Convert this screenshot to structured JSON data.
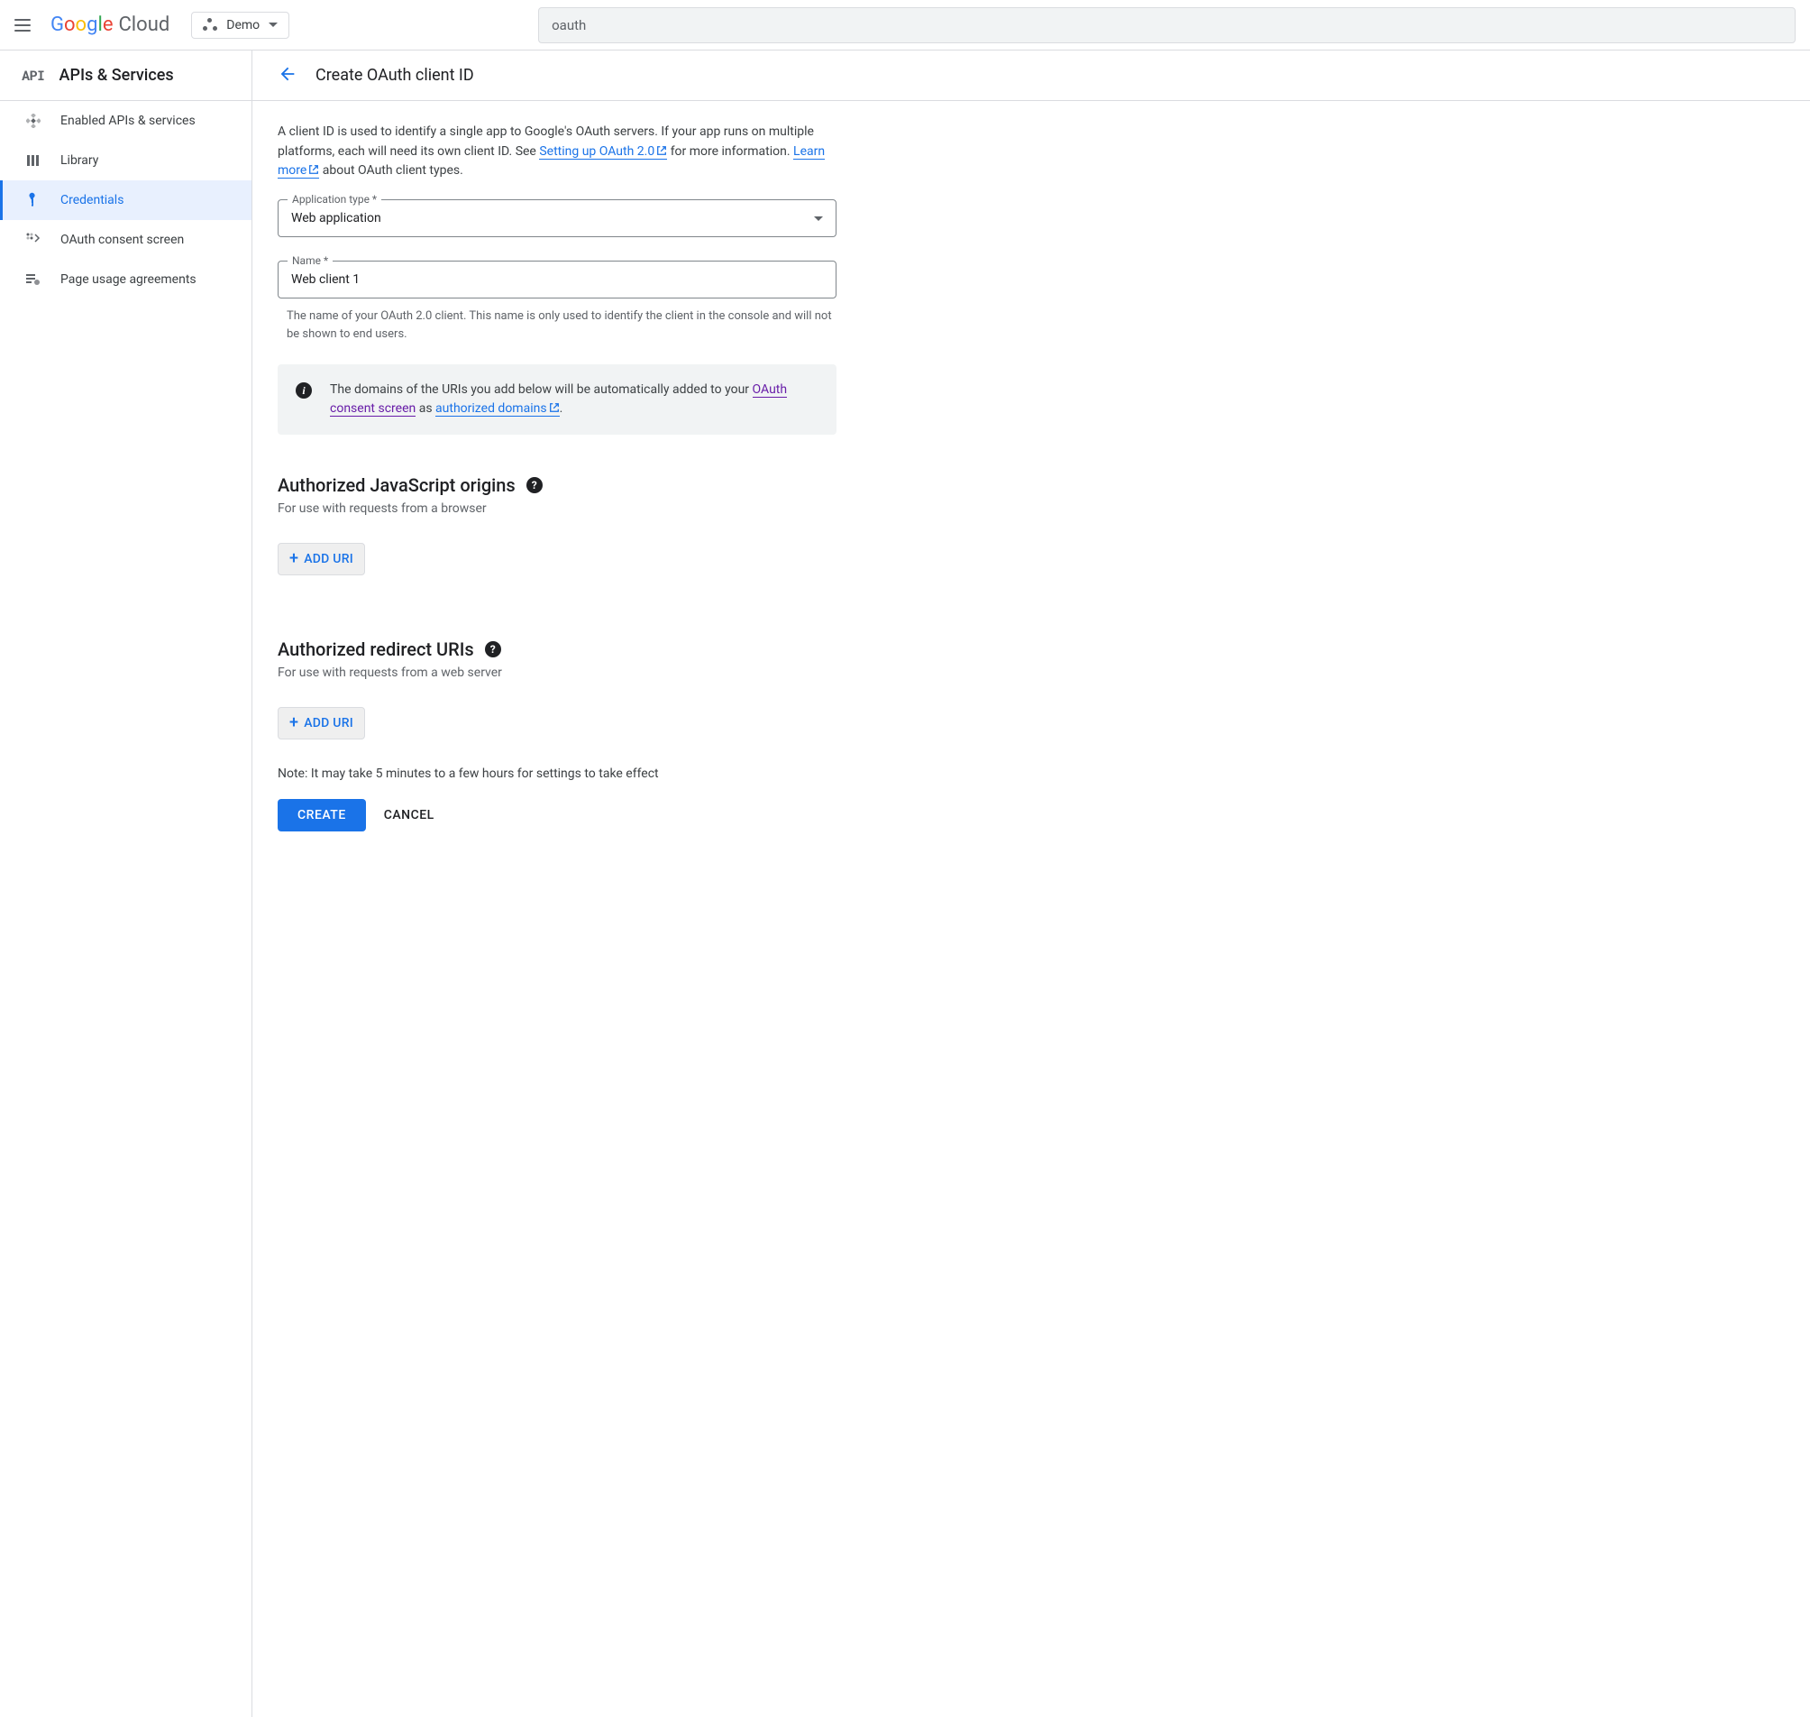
{
  "header": {
    "logo_text_google": "Google",
    "logo_text_cloud": "Cloud",
    "project_name": "Demo",
    "search_value": "oauth"
  },
  "sidebar": {
    "badge": "API",
    "title": "APIs & Services",
    "items": [
      {
        "label": "Enabled APIs & services"
      },
      {
        "label": "Library"
      },
      {
        "label": "Credentials"
      },
      {
        "label": "OAuth consent screen"
      },
      {
        "label": "Page usage agreements"
      }
    ],
    "active_index": 2
  },
  "main": {
    "page_title": "Create OAuth client ID",
    "intro_pre": "A client ID is used to identify a single app to Google's OAuth servers. If your app runs on multiple platforms, each will need its own client ID. See ",
    "intro_link1": "Setting up OAuth 2.0",
    "intro_mid": " for more information. ",
    "intro_link2": "Learn more",
    "intro_post": " about OAuth client types.",
    "app_type_label": "Application type *",
    "app_type_value": "Web application",
    "name_label": "Name *",
    "name_value": "Web client 1",
    "name_helper": "The name of your OAuth 2.0 client. This name is only used to identify the client in the console and will not be shown to end users.",
    "info_pre": "The domains of the URIs you add below will be automatically added to your ",
    "info_link1": "OAuth consent screen",
    "info_mid": " as ",
    "info_link2": "authorized domains",
    "info_post": ".",
    "js_origins_title": "Authorized JavaScript origins",
    "js_origins_sub": "For use with requests from a browser",
    "redirect_title": "Authorized redirect URIs",
    "redirect_sub": "For use with requests from a web server",
    "add_uri_label": "ADD URI",
    "note": "Note: It may take 5 minutes to a few hours for settings to take effect",
    "create_label": "CREATE",
    "cancel_label": "CANCEL"
  }
}
